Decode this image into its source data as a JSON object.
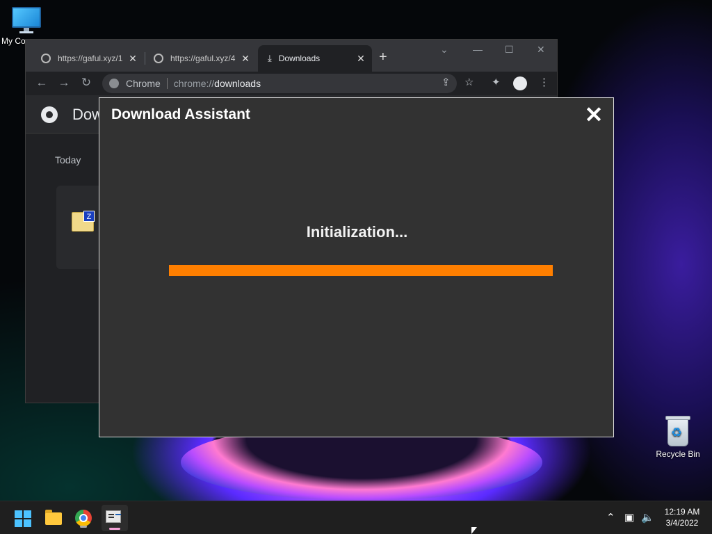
{
  "desktop": {
    "icons": [
      {
        "label": "My Co"
      },
      {
        "label": "Recycle Bin"
      }
    ]
  },
  "browser": {
    "tabs": [
      {
        "title": "https://gaful.xyz/1",
        "close": "✕"
      },
      {
        "title": "https://gaful.xyz/4",
        "close": "✕"
      },
      {
        "title": "Downloads",
        "close": "✕"
      }
    ],
    "new_tab": "+",
    "omnibox": {
      "site": "Chrome",
      "scheme": "chrome://",
      "path": "downloads"
    },
    "page": {
      "title": "Dow",
      "section": "Today"
    }
  },
  "assistant": {
    "title": "Download Assistant",
    "close": "✕",
    "status": "Initialization...",
    "progress_percent": 100,
    "progress_color": "#ff7f00"
  },
  "taskbar": {
    "time": "12:19 AM",
    "date": "3/4/2022"
  }
}
